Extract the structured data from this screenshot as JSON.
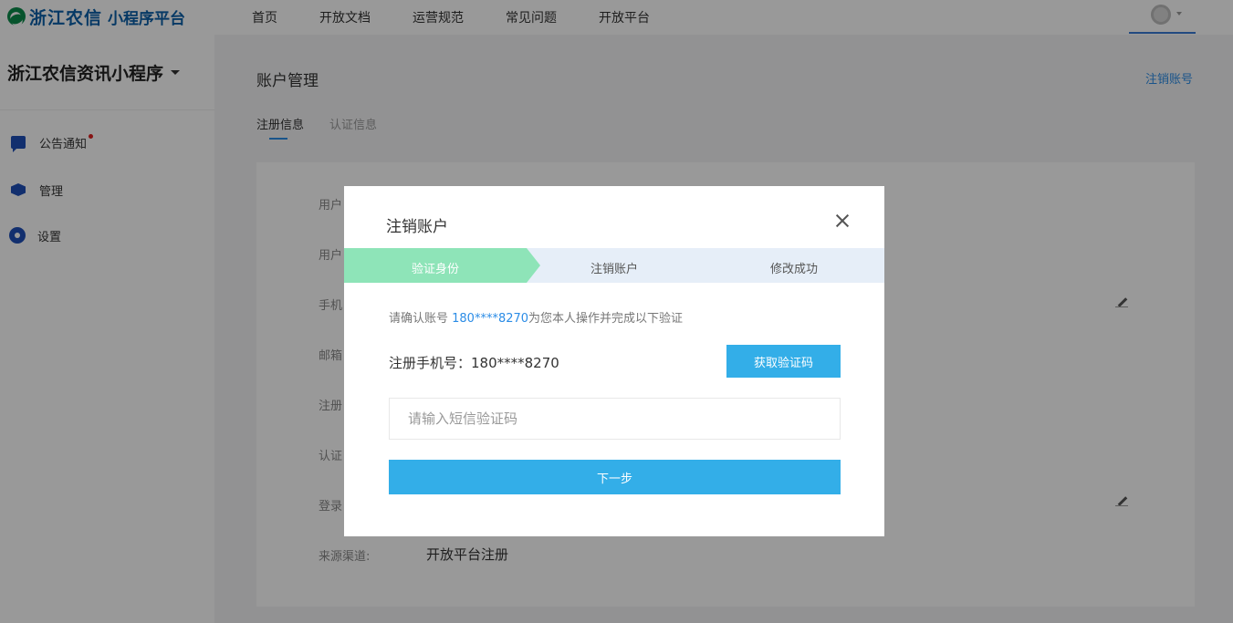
{
  "header": {
    "logo_text": "浙江农信",
    "logo_sub": "小程序平台",
    "nav": [
      "首页",
      "开放文档",
      "运营规范",
      "常见问题",
      "开放平台"
    ]
  },
  "sidebar": {
    "app_name": "浙江农信资讯小程序",
    "items": [
      {
        "label": "公告通知",
        "icon": "chat-icon"
      },
      {
        "label": "管理",
        "icon": "cube-icon"
      },
      {
        "label": "设置",
        "icon": "gear-icon"
      }
    ]
  },
  "main": {
    "title": "账户管理",
    "logout_link": "注销账号",
    "tabs": [
      "注册信息",
      "认证信息"
    ],
    "rows": [
      {
        "label": "用户",
        "value": ""
      },
      {
        "label": "用户",
        "value": ""
      },
      {
        "label": "手机",
        "value": ""
      },
      {
        "label": "邮箱",
        "value": ""
      },
      {
        "label": "注册",
        "value": ""
      },
      {
        "label": "认证",
        "value": ""
      },
      {
        "label": "登录",
        "value": ""
      },
      {
        "label": "来源渠道:",
        "value": "开放平台注册"
      }
    ]
  },
  "modal": {
    "title": "注销账户",
    "steps": [
      "验证身份",
      "注销账户",
      "修改成功"
    ],
    "active_step": 0,
    "confirm_prefix": "请确认账号 ",
    "confirm_phone": "180****8270",
    "confirm_suffix": "为您本人操作并完成以下验证",
    "phone_label": "注册手机号：180****8270",
    "get_code_label": "获取验证码",
    "code_placeholder": "请输入短信验证码",
    "next_label": "下一步"
  },
  "colors": {
    "accent": "#33aee8",
    "link": "#2b8ce6",
    "step_active": "#8ee4b8",
    "step_inactive": "#e6eef8"
  }
}
